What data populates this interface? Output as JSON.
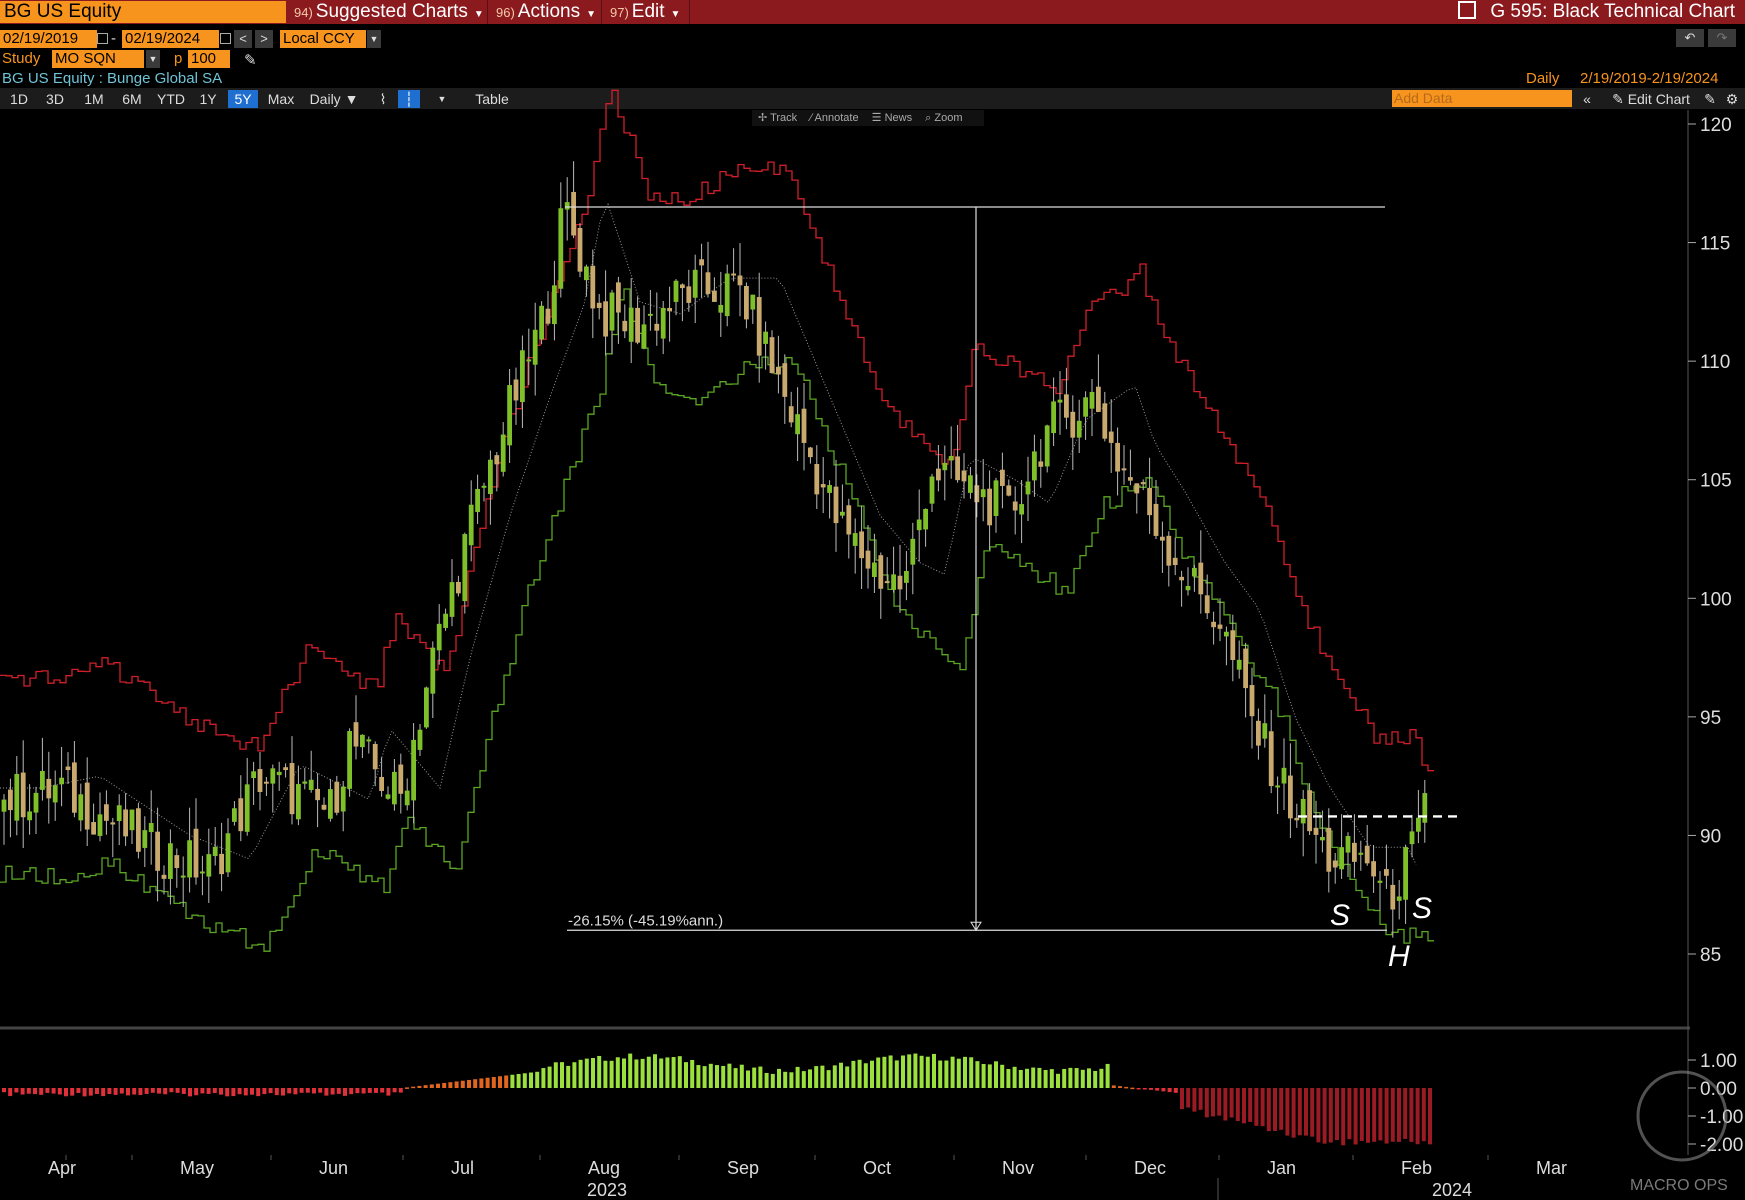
{
  "header": {
    "ticker": "BG US Equity",
    "menu": [
      {
        "num": "94)",
        "label": "Suggested Charts"
      },
      {
        "num": "96)",
        "label": "Actions"
      },
      {
        "num": "97)",
        "label": "Edit"
      }
    ],
    "page_title": "G 595: Black Technical Chart"
  },
  "controls": {
    "start_date": "02/19/2019",
    "end_date": "02/19/2024",
    "currency": "Local CCY",
    "study_label": "Study",
    "study_value": "MO SQN",
    "p_label": "p",
    "p_value": "100",
    "security_line": "BG US Equity : Bunge Global SA",
    "frequency_display": "Daily",
    "range_display": "2/19/2019-2/19/2024",
    "add_data_placeholder": "Add Data",
    "edit_chart_label": "Edit Chart"
  },
  "toolbar": {
    "periods": [
      "1D",
      "3D",
      "1M",
      "6M",
      "YTD",
      "1Y",
      "5Y",
      "Max"
    ],
    "active_period": "5Y",
    "frequency": "Daily ▼",
    "table_label": "Table",
    "tools": [
      "Track",
      "Annotate",
      "News",
      "Zoom"
    ]
  },
  "annotations": {
    "measure_text": "-26.15% (-45.19%ann.)",
    "left_shoulder": "S",
    "head": "H",
    "right_shoulder": "S",
    "watermark": "MACRO OPS"
  },
  "colors": {
    "titlebar": "#8b1a1f",
    "orange": "#f7941d",
    "up_candle": "#7fbf2a",
    "down_candle": "#c9a96e",
    "upper_band": "#d11f2a",
    "lower_band": "#5aa624",
    "osc_positive": "#9be03c",
    "osc_warm": "#e0661f",
    "osc_negative": "#9a1b24"
  },
  "chart_data": {
    "type": "candlestick",
    "title": "",
    "y_axis": {
      "ticks": [
        120,
        115,
        110,
        105,
        100,
        95,
        90,
        85
      ],
      "ylim": [
        82,
        121
      ]
    },
    "x_axis": {
      "months": [
        "Apr",
        "May",
        "Jun",
        "Jul",
        "Aug",
        "Sep",
        "Oct",
        "Nov",
        "Dec",
        "Jan",
        "Feb",
        "Mar"
      ],
      "years": [
        "2023",
        "2024"
      ]
    },
    "close_path": [
      {
        "month": "Apr",
        "close": 91.5
      },
      {
        "month": "May",
        "close": 89.5
      },
      {
        "month": "Jun",
        "close": 92
      },
      {
        "month": "Jul",
        "close": 97
      },
      {
        "month": "Jul-end",
        "close": 112
      },
      {
        "month": "Aug",
        "close": 111
      },
      {
        "month": "Sep",
        "close": 113
      },
      {
        "month": "Oct",
        "close": 102
      },
      {
        "month": "Oct-mid",
        "close": 106
      },
      {
        "month": "Nov",
        "close": 107.5
      },
      {
        "month": "Dec",
        "close": 104
      },
      {
        "month": "Jan",
        "close": 93
      },
      {
        "month": "Jan-end",
        "close": 88
      },
      {
        "month": "Feb",
        "close": 91.5
      }
    ],
    "measure": {
      "from_price": 116.5,
      "to_price": 86.0,
      "text": "-26.15% (-45.19%ann.)"
    },
    "neckline": 90.8,
    "oscillator": {
      "ticks": [
        1.0,
        0.0,
        -1.0,
        -2.0
      ],
      "ylim": [
        -2.2,
        1.6
      ]
    }
  }
}
